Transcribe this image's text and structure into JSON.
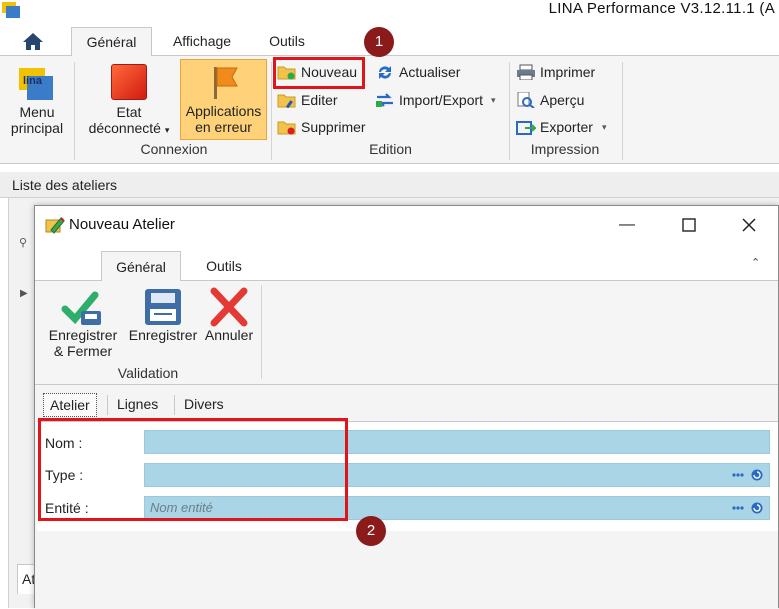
{
  "app": {
    "title": "LINA Performance  V3.12.11.1  (A"
  },
  "main_tabs": [
    {
      "label": "Général",
      "active": true
    },
    {
      "label": "Affichage",
      "active": false
    },
    {
      "label": "Outils",
      "active": false
    }
  ],
  "ribbon": {
    "menu_principal": {
      "line1": "Menu",
      "line2": "principal"
    },
    "connexion": {
      "group_label": "Connexion",
      "etat": {
        "line1": "Etat",
        "line2": "déconnecté"
      },
      "applications": {
        "line1": "Applications",
        "line2": "en erreur"
      }
    },
    "edition": {
      "group_label": "Edition",
      "nouveau": "Nouveau",
      "editer": "Editer",
      "supprimer": "Supprimer",
      "actualiser": "Actualiser",
      "import_export": "Import/Export"
    },
    "impression": {
      "group_label": "Impression",
      "imprimer": "Imprimer",
      "apercu": "Aperçu",
      "exporter": "Exporter"
    }
  },
  "list": {
    "header": "Liste des ateliers",
    "bottom_tab": "At"
  },
  "annotations": {
    "marker1": "1",
    "marker2": "2"
  },
  "dialog": {
    "title": "Nouveau Atelier",
    "tabs": [
      {
        "label": "Général",
        "active": true
      },
      {
        "label": "Outils",
        "active": false
      }
    ],
    "validation": {
      "group_label": "Validation",
      "save_close": {
        "line1": "Enregistrer",
        "line2": "& Fermer"
      },
      "save": "Enregistrer",
      "cancel": "Annuler"
    },
    "form_tabs": [
      {
        "label": "Atelier",
        "active": true
      },
      {
        "label": "Lignes",
        "active": false
      },
      {
        "label": "Divers",
        "active": false
      }
    ],
    "fields": {
      "nom": {
        "label": "Nom :",
        "value": ""
      },
      "type": {
        "label": "Type :",
        "value": ""
      },
      "entite": {
        "label": "Entité :",
        "value": "",
        "placeholder": "Nom entité"
      }
    }
  },
  "colors": {
    "accent_red": "#e0141a",
    "marker": "#8b1a1a",
    "field_bg": "#a9d5e6",
    "highlight_orange": "#ffd27a"
  }
}
